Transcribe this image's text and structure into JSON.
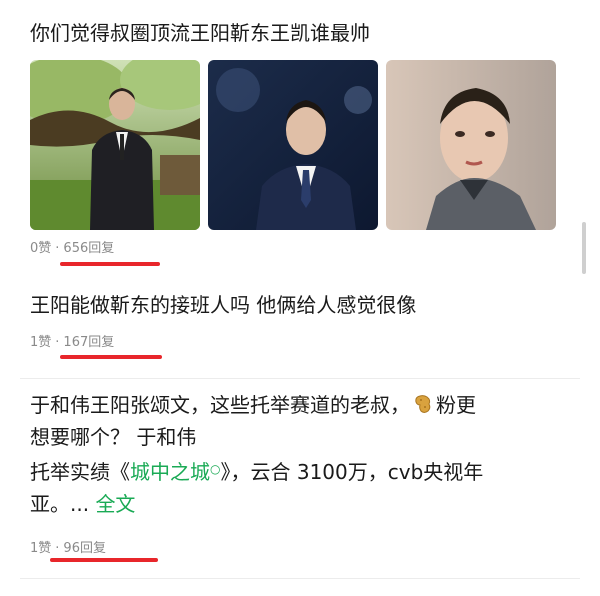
{
  "post1": {
    "title": "你们觉得叔圈顶流王阳靳东王凯谁最帅",
    "likes": "0赞",
    "replies": "656回复"
  },
  "post2": {
    "title": "王阳能做靳东的接班人吗  他俩给人感觉很像",
    "likes": "1赞",
    "replies": "167回复"
  },
  "post3": {
    "line1": "于和伟王阳张颂文，这些托举赛道的老叔，",
    "line1_end": "粉更",
    "line2": "想要哪个？  于和伟",
    "line3_pre": "托举实绩《",
    "line3_link": "城中之城",
    "line3_post": "》，云合 3100万，cvb央视年",
    "line4": "亚。... ",
    "fulltext": "全文",
    "likes": "1赞",
    "replies": "96回复"
  },
  "separator": "·",
  "colors": {
    "accent_green": "#1aaa55",
    "highlight_red": "#e8262b",
    "meta_gray": "#8a8a8a"
  }
}
